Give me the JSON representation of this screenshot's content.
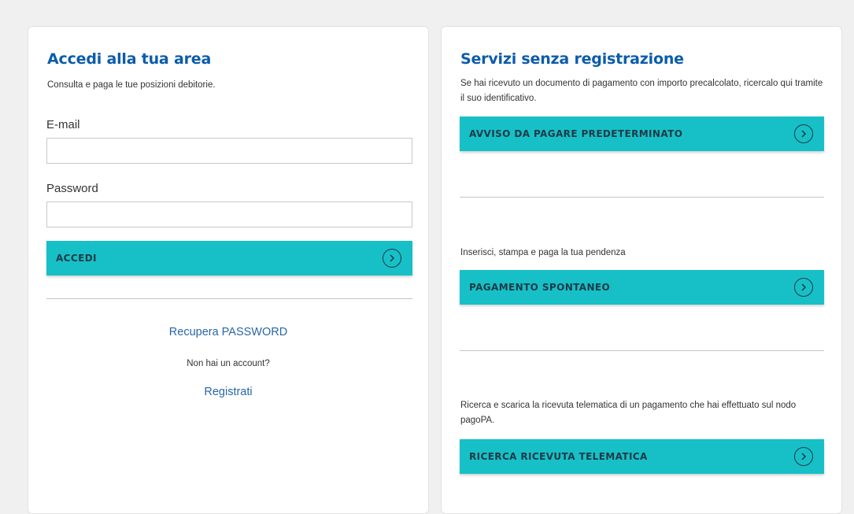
{
  "login": {
    "title": "Accedi alla tua area",
    "subtitle": "Consulta e paga le tue posizioni debitorie.",
    "email_label": "E-mail",
    "email_value": "",
    "password_label": "Password",
    "password_value": "",
    "submit_label": "ACCEDI",
    "recover_link": "Recupera PASSWORD",
    "no_account_text": "Non hai un account?",
    "register_link": "Registrati"
  },
  "services": {
    "title": "Servizi senza registrazione",
    "items": [
      {
        "description": "Se hai ricevuto un documento di pagamento con importo precalcolato, ricercalo qui tramite il suo identificativo.",
        "button_label": "AVVISO DA PAGARE PREDETERMINATO"
      },
      {
        "description": "Inserisci, stampa e paga la tua pendenza",
        "button_label": "PAGAMENTO SPONTANEO"
      },
      {
        "description": "Ricerca e scarica la ricevuta telematica di un pagamento che hai effettuato sul nodo pagoPA.",
        "button_label": "RICERCA RICEVUTA TELEMATICA"
      }
    ]
  },
  "colors": {
    "accent": "#17c0c7",
    "title_blue": "#0b5cab",
    "link_blue": "#2a66a8",
    "background": "#f0f0f0"
  },
  "icons": {
    "button_arrow": "chevron-right-circle-icon"
  }
}
